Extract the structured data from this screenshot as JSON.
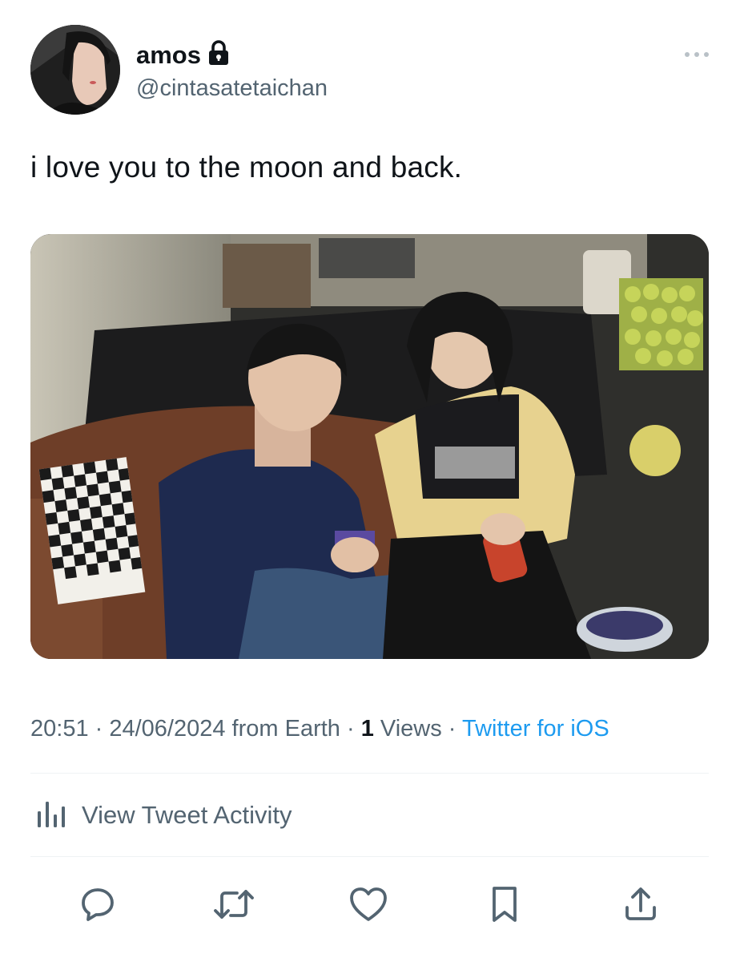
{
  "tweet": {
    "display_name": "amos",
    "handle": "@cintasatetaichan",
    "protected_icon": "lock-icon",
    "text": "i love you to the moon and back.",
    "time": "20:51",
    "sep1": " · ",
    "date": "24/06/2024 from Earth",
    "sep2": " · ",
    "views_count": "1",
    "views_label": " Views",
    "sep3": " · ",
    "source": "Twitter for iOS"
  },
  "activity": {
    "label": "View Tweet Activity",
    "icon": "bar-chart-icon"
  },
  "actions": [
    {
      "icon": "reply-icon"
    },
    {
      "icon": "retweet-icon"
    },
    {
      "icon": "like-icon"
    },
    {
      "icon": "bookmark-icon"
    },
    {
      "icon": "share-icon"
    }
  ],
  "colors": {
    "text": "#0f1419",
    "secondary": "#536471",
    "link": "#1d9bf0",
    "divider": "#eff3f4"
  }
}
